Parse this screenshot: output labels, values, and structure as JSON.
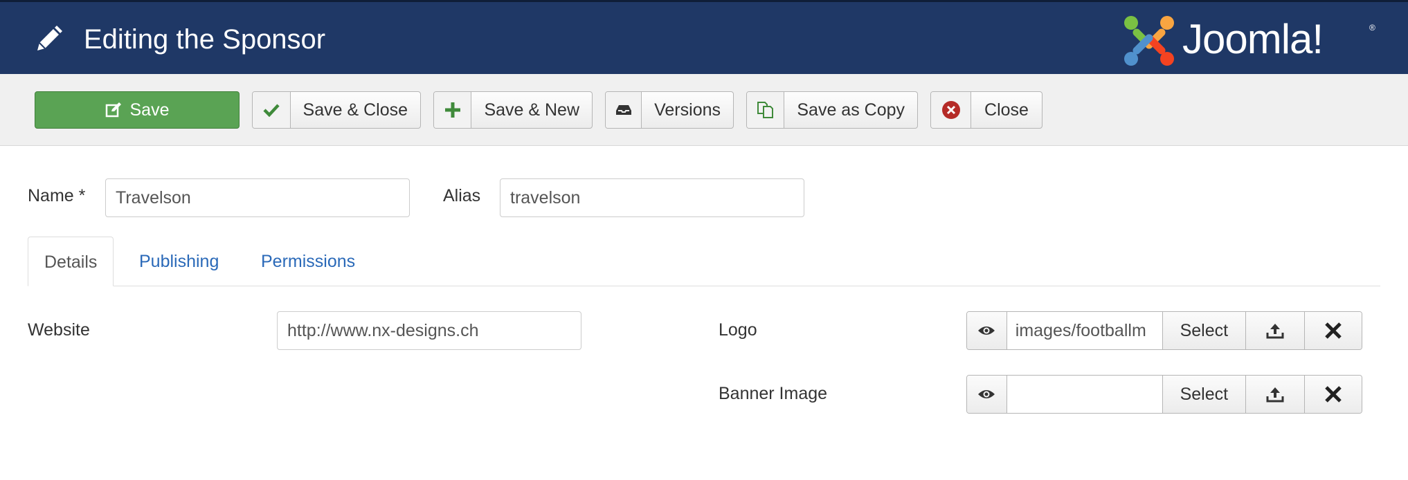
{
  "header": {
    "title": "Editing the Sponsor",
    "brand": "Joomla!",
    "brand_mark": "®"
  },
  "toolbar": {
    "save": "Save",
    "save_close": "Save & Close",
    "save_new": "Save & New",
    "versions": "Versions",
    "save_copy": "Save as Copy",
    "close": "Close"
  },
  "form": {
    "name_label": "Name *",
    "name_value": "Travelson",
    "alias_label": "Alias",
    "alias_value": "travelson"
  },
  "tabs": [
    {
      "label": "Details",
      "active": true
    },
    {
      "label": "Publishing",
      "active": false
    },
    {
      "label": "Permissions",
      "active": false
    }
  ],
  "details": {
    "website_label": "Website",
    "website_value": "http://www.nx-designs.ch",
    "logo_label": "Logo",
    "logo_value": "images/footballm",
    "banner_label": "Banner Image",
    "banner_value": "",
    "select_label": "Select"
  },
  "colors": {
    "header_bg": "#1f3866",
    "save_green": "#5aa354",
    "link_blue": "#2a69b8",
    "close_red": "#b52b27"
  },
  "icons": [
    "pencil-icon",
    "joomla-logo",
    "edit-icon",
    "check-icon",
    "plus-icon",
    "archive-icon",
    "copy-icon",
    "close-circle-icon",
    "eye-icon",
    "upload-icon",
    "x-icon"
  ]
}
